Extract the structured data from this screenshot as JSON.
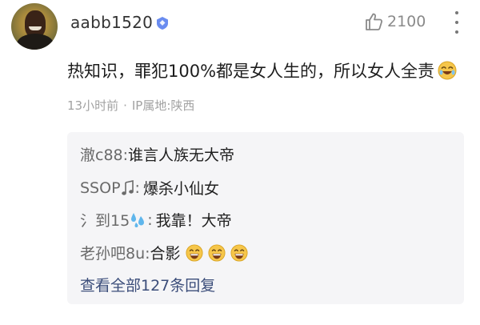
{
  "user": {
    "name": "aabb1520",
    "badge_icon": "verified-shield-icon",
    "badge_color": "#6a8cf0"
  },
  "like": {
    "icon": "thumbs-up-icon",
    "count": "2100"
  },
  "more_icon": "vertical-ellipsis-icon",
  "comment": {
    "text": "热知识，罪犯100%都是女人生的，所以女人全责",
    "emoji": "laughing-face-emoji"
  },
  "meta": {
    "time": "13小时前",
    "separator": "·",
    "location": "IP属地:陕西"
  },
  "replies": [
    {
      "name": "澈c88:",
      "text": "谁言人族无大帝",
      "name_icon": null,
      "emojis": []
    },
    {
      "name": "SSOP",
      "name_suffix": ":",
      "name_icon": "music-note-icon",
      "text": "爆杀小仙女",
      "emojis": []
    },
    {
      "name": "氵到15",
      "name_suffix": ":",
      "name_icon": "sweat-droplets-icon",
      "text": "我靠！大帝",
      "emojis": []
    },
    {
      "name": "老孙吧8u:",
      "text": "合影",
      "name_icon": null,
      "emojis": [
        "grinning-face-emoji",
        "grinning-face-emoji",
        "grinning-face-emoji"
      ]
    }
  ],
  "view_all": "查看全部127条回复",
  "colors": {
    "reply_bg": "#f5f5f7",
    "link": "#3b4d7a",
    "muted": "#a2a2a2"
  }
}
